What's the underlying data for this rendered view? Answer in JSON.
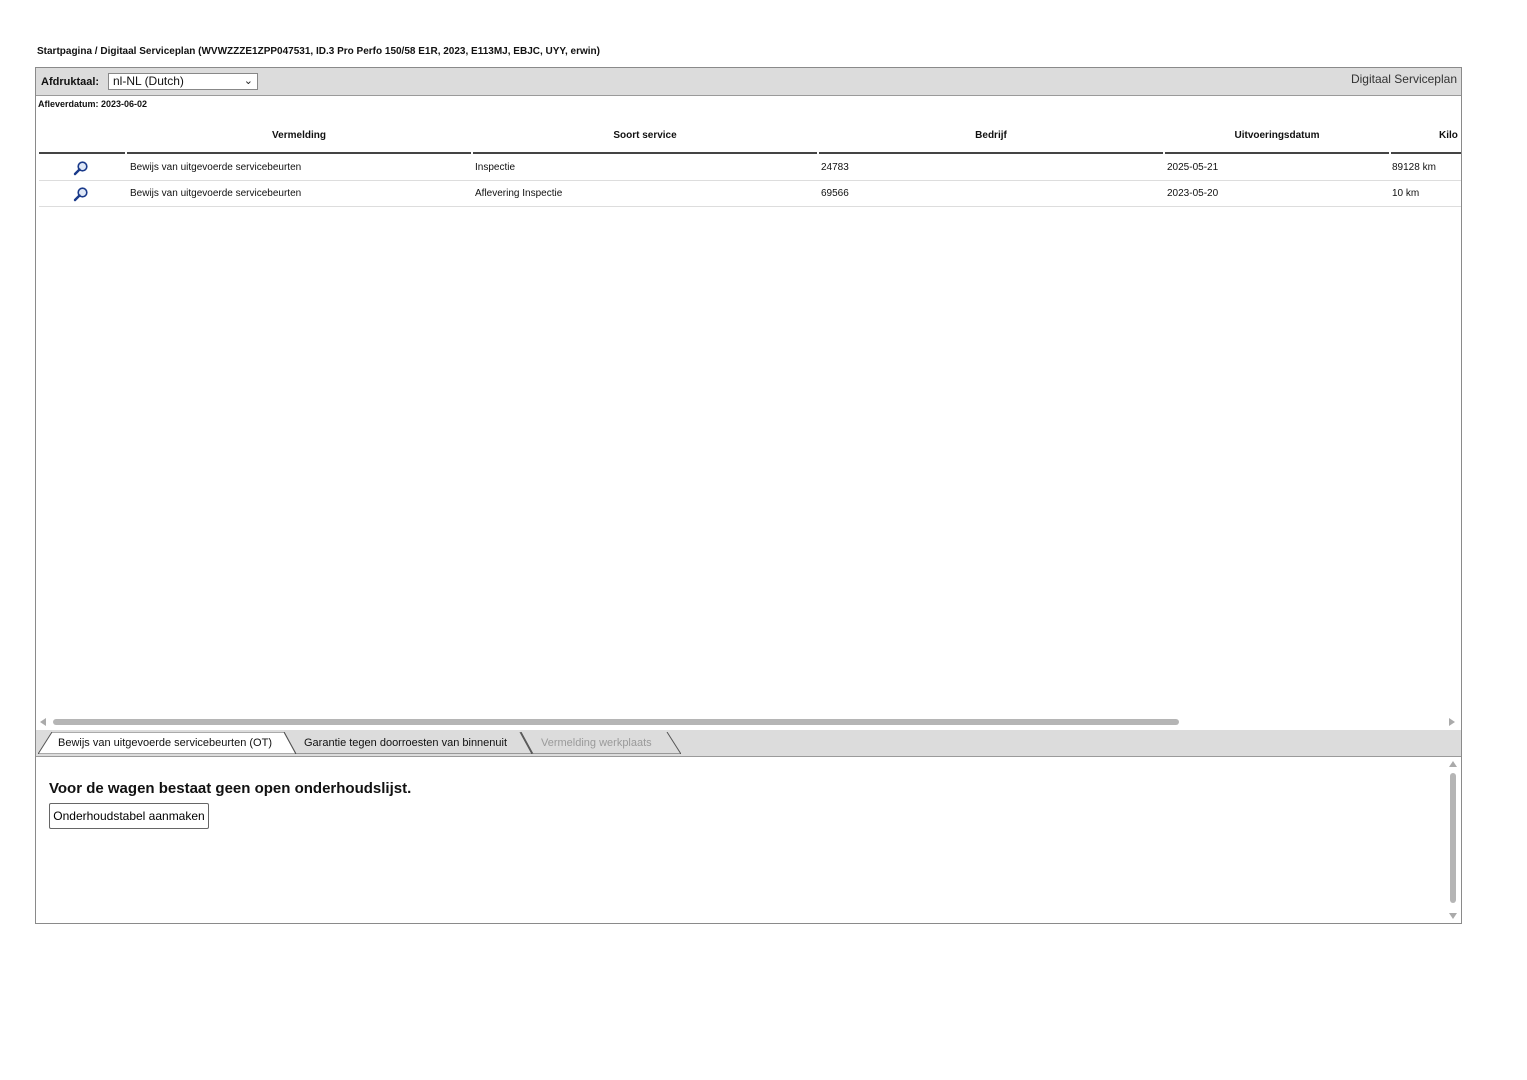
{
  "breadcrumb": "Startpagina / Digitaal Serviceplan (WVWZZZE1ZPP047531, ID.3 Pro Perfo 150/58 E1R, 2023, E113MJ, EBJC, UYY, erwin)",
  "toolbar": {
    "print_language_label": "Afdruktaal:",
    "print_language_value": "nl-NL (Dutch)",
    "app_title": "Digitaal Serviceplan"
  },
  "delivery_date": "Afleverdatum: 2023-06-02",
  "table": {
    "columns": [
      "Vermelding",
      "Soort service",
      "Bedrijf",
      "Uitvoeringsdatum",
      "Kilo"
    ],
    "rows": [
      {
        "icon": "magnifier-icon",
        "vermelding": "Bewijs van uitgevoerde servicebeurten",
        "soort": "Inspectie",
        "bedrijf": "24783",
        "datum": "2025-05-21",
        "km": "89128 km"
      },
      {
        "icon": "magnifier-icon",
        "vermelding": "Bewijs van uitgevoerde servicebeurten",
        "soort": "Aflevering Inspectie",
        "bedrijf": "69566",
        "datum": "2023-05-20",
        "km": "10 km"
      }
    ]
  },
  "tabs": [
    {
      "label": "Bewijs van uitgevoerde servicebeurten (OT)",
      "state": "active"
    },
    {
      "label": "Garantie tegen doorroesten van binnenuit",
      "state": "normal"
    },
    {
      "label": "Vermelding werkplaats",
      "state": "disabled"
    }
  ],
  "lower": {
    "message": "Voor de wagen bestaat geen open onderhoudslijst.",
    "create_button": "Onderhoudstabel aanmaken"
  },
  "colors": {
    "bar_bg": "#dcdcdc",
    "border": "#8a8a8a",
    "icon_blue": "#1a3a8a",
    "disabled_text": "#9a9a9a"
  }
}
